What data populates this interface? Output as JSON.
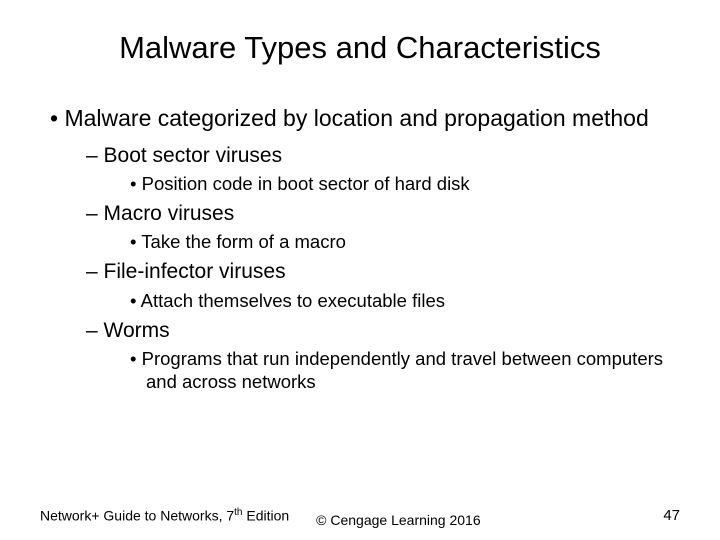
{
  "slide": {
    "title": "Malware Types and Characteristics",
    "bullets": {
      "main": "Malware categorized by location and propagation method",
      "items": [
        {
          "label": "Boot sector viruses",
          "detail": "Position code in boot sector of hard disk"
        },
        {
          "label": "Macro viruses",
          "detail": "Take the form of a macro"
        },
        {
          "label": "File-infector viruses",
          "detail": "Attach themselves to executable files"
        },
        {
          "label": "Worms",
          "detail": "Programs that run independently and travel between computers and across networks"
        }
      ]
    },
    "footer": {
      "left_prefix": "Network+ Guide to Networks, 7",
      "left_suffix_super": "th",
      "left_tail": " Edition",
      "center": "© Cengage Learning  2016",
      "page": "47"
    }
  }
}
